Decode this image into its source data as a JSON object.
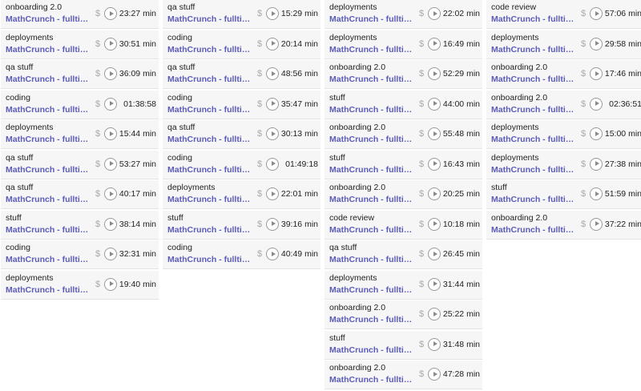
{
  "columns": [
    [
      {
        "description": "onboarding 2.0",
        "project": "MathCrunch - fulltime...",
        "duration": "23:27 min"
      },
      {
        "description": "deployments",
        "project": "MathCrunch - fulltime...",
        "duration": "30:51 min"
      },
      {
        "description": "qa stuff",
        "project": "MathCrunch - fulltime...",
        "duration": "36:09 min"
      },
      {
        "description": "coding",
        "project": "MathCrunch - fulltime...",
        "duration": "01:38:58"
      },
      {
        "description": "deployments",
        "project": "MathCrunch - fulltime...",
        "duration": "15:44 min"
      },
      {
        "description": "qa stuff",
        "project": "MathCrunch - fulltime...",
        "duration": "53:27 min"
      },
      {
        "description": "qa stuff",
        "project": "MathCrunch - fulltime...",
        "duration": "40:17 min"
      },
      {
        "description": "stuff",
        "project": "MathCrunch - fulltime...",
        "duration": "38:14 min"
      },
      {
        "description": "coding",
        "project": "MathCrunch - fulltime...",
        "duration": "32:31 min"
      },
      {
        "description": "deployments",
        "project": "MathCrunch - fulltime...",
        "duration": "19:40 min"
      }
    ],
    [
      {
        "description": "qa stuff",
        "project": "MathCrunch - fulltime...",
        "duration": "15:29 min"
      },
      {
        "description": "coding",
        "project": "MathCrunch - fulltime...",
        "duration": "20:14 min"
      },
      {
        "description": "qa stuff",
        "project": "MathCrunch - fulltime...",
        "duration": "48:56 min"
      },
      {
        "description": "coding",
        "project": "MathCrunch - fulltime...",
        "duration": "35:47 min"
      },
      {
        "description": "qa stuff",
        "project": "MathCrunch - fulltime...",
        "duration": "30:13 min"
      },
      {
        "description": "coding",
        "project": "MathCrunch - fulltime...",
        "duration": "01:49:18"
      },
      {
        "description": "deployments",
        "project": "MathCrunch - fulltime...",
        "duration": "22:01 min"
      },
      {
        "description": "stuff",
        "project": "MathCrunch - fulltime...",
        "duration": "39:16 min"
      },
      {
        "description": "coding",
        "project": "MathCrunch - fulltime...",
        "duration": "40:49 min"
      }
    ],
    [
      {
        "description": "deployments",
        "project": "MathCrunch - fulltime...",
        "duration": "22:02 min"
      },
      {
        "description": "deployments",
        "project": "MathCrunch - fulltime...",
        "duration": "16:49 min"
      },
      {
        "description": "onboarding 2.0",
        "project": "MathCrunch - fulltime...",
        "duration": "52:29 min"
      },
      {
        "description": "stuff",
        "project": "MathCrunch - fulltime...",
        "duration": "44:00 min"
      },
      {
        "description": "onboarding 2.0",
        "project": "MathCrunch - fulltime...",
        "duration": "55:48 min"
      },
      {
        "description": "stuff",
        "project": "MathCrunch - fulltime...",
        "duration": "16:43 min"
      },
      {
        "description": "onboarding 2.0",
        "project": "MathCrunch - fulltime...",
        "duration": "20:25 min"
      },
      {
        "description": "code review",
        "project": "MathCrunch - fulltime...",
        "duration": "10:18 min"
      },
      {
        "description": "qa stuff",
        "project": "MathCrunch - fulltime...",
        "duration": "26:45 min"
      },
      {
        "description": "deployments",
        "project": "MathCrunch - fulltime...",
        "duration": "31:44 min"
      },
      {
        "description": "onboarding 2.0",
        "project": "MathCrunch - fulltime...",
        "duration": "25:22 min"
      },
      {
        "description": "stuff",
        "project": "MathCrunch - fulltime...",
        "duration": "31:48 min"
      },
      {
        "description": "onboarding 2.0",
        "project": "MathCrunch - fulltime...",
        "duration": "47:28 min"
      }
    ],
    [
      {
        "description": "code review",
        "project": "MathCrunch - fulltime...",
        "duration": "57:06 min"
      },
      {
        "description": "deployments",
        "project": "MathCrunch - fulltime...",
        "duration": "29:58 min"
      },
      {
        "description": "onboarding 2.0",
        "project": "MathCrunch - fulltime...",
        "duration": "17:46 min"
      },
      {
        "description": "onboarding 2.0",
        "project": "MathCrunch - fulltime...",
        "duration": "02:36:51"
      },
      {
        "description": "deployments",
        "project": "MathCrunch - fulltime...",
        "duration": "15:00 min"
      },
      {
        "description": "deployments",
        "project": "MathCrunch - fulltime...",
        "duration": "27:38 min"
      },
      {
        "description": "stuff",
        "project": "MathCrunch - fulltime...",
        "duration": "51:59 min"
      },
      {
        "description": "onboarding 2.0",
        "project": "MathCrunch - fulltime...",
        "duration": "37:22 min"
      }
    ]
  ],
  "billable_glyph": "$",
  "colors": {
    "project_link": "#5b5bb8",
    "row_background": "#f6f6f6",
    "icon_gray": "#9a9a9a"
  }
}
